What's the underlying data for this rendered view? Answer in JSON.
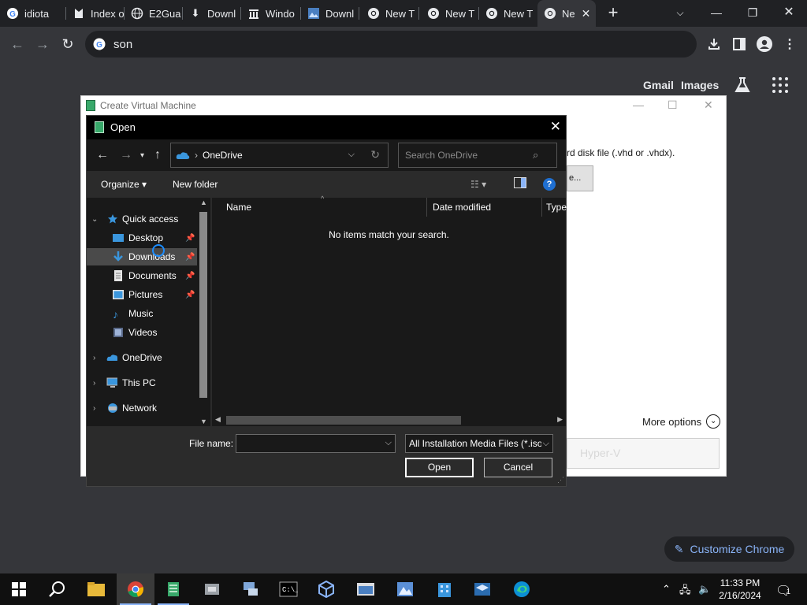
{
  "tabs": [
    {
      "label": "idiota",
      "icon": "google-icon"
    },
    {
      "label": "Index o",
      "icon": "bookmark-icon"
    },
    {
      "label": "E2Gua",
      "icon": "globe-icon"
    },
    {
      "label": "Downl",
      "icon": "download-icon"
    },
    {
      "label": "Windo",
      "icon": "archive-icon"
    },
    {
      "label": "Downl",
      "icon": "image-icon"
    },
    {
      "label": "New T",
      "icon": "chrome-icon"
    },
    {
      "label": "New T",
      "icon": "chrome-icon"
    },
    {
      "label": "New T",
      "icon": "chrome-icon"
    },
    {
      "label": "Ne",
      "icon": "chrome-icon",
      "active": true
    }
  ],
  "omnibox": {
    "value": "son"
  },
  "ntp": {
    "gmail": "Gmail",
    "images": "Images",
    "customize": "Customize Chrome"
  },
  "vm_window": {
    "title": "Create Virtual Machine",
    "text_fragment": "rd disk file (.vhd or .vhdx).",
    "browse_fragment": "e...",
    "more_options": "More options",
    "create_button": "Hyper-V"
  },
  "dialog": {
    "title": "Open",
    "location": "OneDrive",
    "search_placeholder": "Search OneDrive",
    "organize": "Organize",
    "new_folder": "New folder",
    "help": "?",
    "nav": [
      {
        "label": "Quick access",
        "icon": "star-icon",
        "level": 0,
        "expanded": true
      },
      {
        "label": "Desktop",
        "icon": "desktop-icon",
        "level": 1,
        "pinned": true
      },
      {
        "label": "Downloads",
        "icon": "downloads-icon",
        "level": 1,
        "pinned": true,
        "selected": true
      },
      {
        "label": "Documents",
        "icon": "documents-icon",
        "level": 1,
        "pinned": true
      },
      {
        "label": "Pictures",
        "icon": "pictures-icon",
        "level": 1,
        "pinned": true
      },
      {
        "label": "Music",
        "icon": "music-icon",
        "level": 1
      },
      {
        "label": "Videos",
        "icon": "videos-icon",
        "level": 1
      },
      {
        "label": "OneDrive",
        "icon": "onedrive-icon",
        "level": 0
      },
      {
        "label": "This PC",
        "icon": "pc-icon",
        "level": 0
      },
      {
        "label": "Network",
        "icon": "network-icon",
        "level": 0
      }
    ],
    "columns": [
      "Name",
      "Date modified",
      "Type"
    ],
    "empty_message": "No items match your search.",
    "file_name_label": "File name:",
    "file_name_value": "",
    "filter": "All Installation Media Files (*.iso",
    "open_button": "Open",
    "cancel_button": "Cancel"
  },
  "taskbar": {
    "time": "11:33 PM",
    "date": "2/16/2024",
    "notifications": "1"
  },
  "colors": {
    "chrome_dark": "#202124",
    "dialog_bg": "#191919",
    "accent": "#8ab4f8"
  }
}
